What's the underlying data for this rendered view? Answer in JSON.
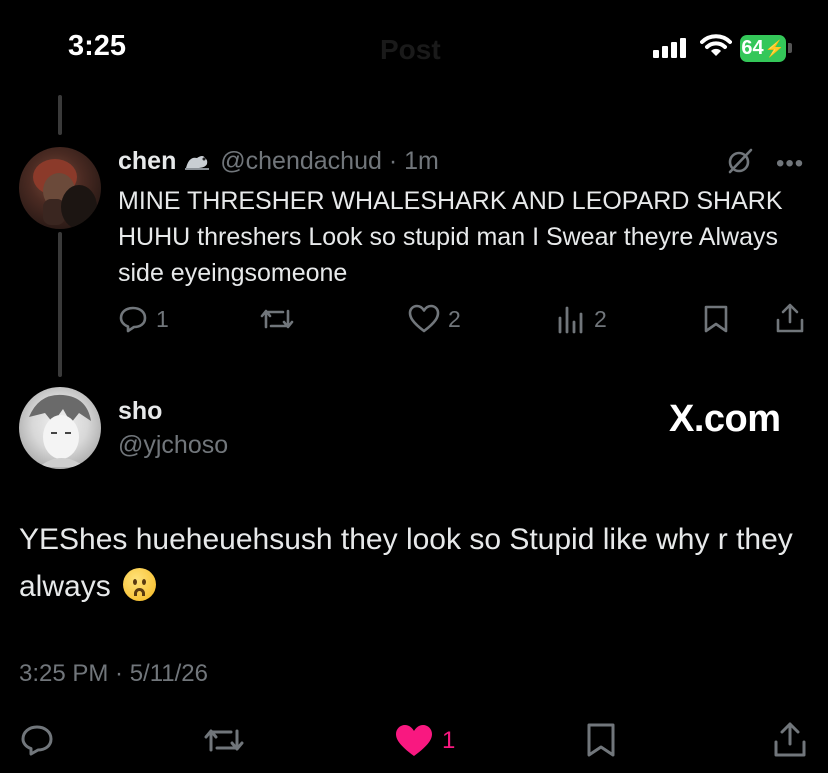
{
  "status_bar": {
    "time": "3:25",
    "faded_title": "Post",
    "battery": "64"
  },
  "reply": {
    "name": "chen",
    "handle": "@chendachud",
    "age": " · 1m",
    "text": "MINE THRESHER WHALESHARK AND LEOPARD SHARK HUHU threshers Look so stupid man I Swear theyre Always side eyeingsomeone",
    "actions": {
      "replies": "1",
      "likes": "2",
      "views": "2"
    }
  },
  "post": {
    "name": "sho",
    "handle": "@yjchoso",
    "brand": "X.com",
    "text": "YEShes hueheuehsush they look so Stupid like why r they always",
    "timestamp": "3:25 PM · 5/11/26",
    "likes": "1"
  },
  "colors": {
    "background": "#000000",
    "text": "#e7e9ea",
    "muted": "#71767b",
    "like_active": "#f91880",
    "battery": "#34c759"
  }
}
